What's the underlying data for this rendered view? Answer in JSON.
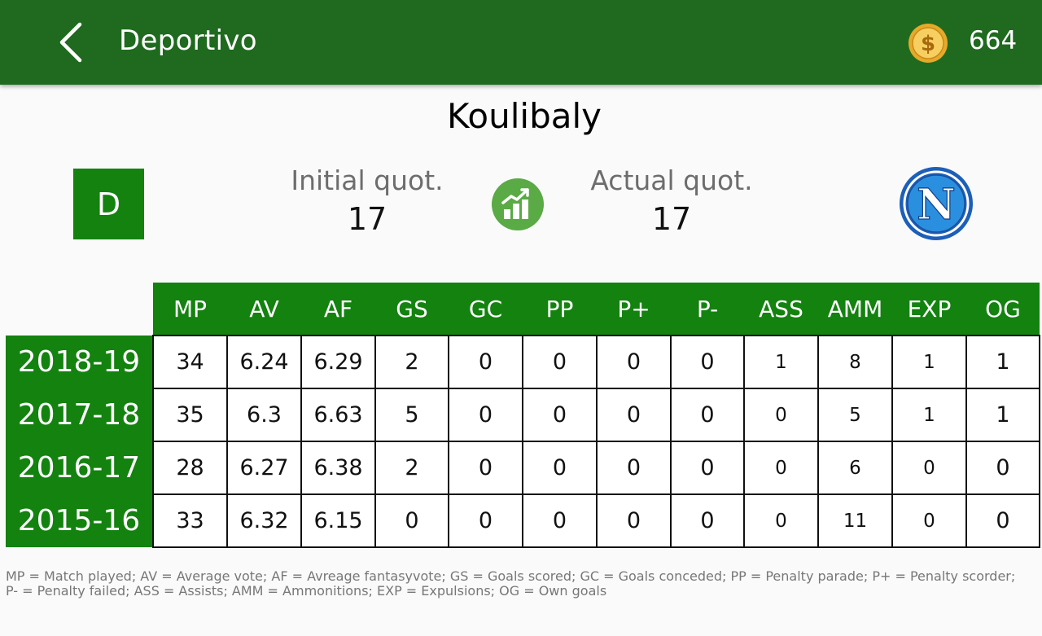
{
  "header": {
    "title": "Deportivo",
    "coins": "664",
    "back_icon": "chevron-left-icon",
    "coin_icon": "coin-icon"
  },
  "player": {
    "name": "Koulibaly",
    "role": "D",
    "initial_label": "Initial quot.",
    "initial_value": "17",
    "actual_label": "Actual quot.",
    "actual_value": "17",
    "trend_icon": "trend-chart-icon",
    "team_logo_letter": "N"
  },
  "table": {
    "columns": [
      "MP",
      "AV",
      "AF",
      "GS",
      "GC",
      "PP",
      "P+",
      "P-",
      "ASS",
      "AMM",
      "EXP",
      "OG"
    ],
    "rows": [
      {
        "season": "2018-19",
        "values": [
          "34",
          "6.24",
          "6.29",
          "2",
          "0",
          "0",
          "0",
          "0",
          "1",
          "8",
          "1",
          "1"
        ]
      },
      {
        "season": "2017-18",
        "values": [
          "35",
          "6.3",
          "6.63",
          "5",
          "0",
          "0",
          "0",
          "0",
          "0",
          "5",
          "1",
          "1"
        ]
      },
      {
        "season": "2016-17",
        "values": [
          "28",
          "6.27",
          "6.38",
          "2",
          "0",
          "0",
          "0",
          "0",
          "0",
          "6",
          "0",
          "0"
        ]
      },
      {
        "season": "2015-16",
        "values": [
          "33",
          "6.32",
          "6.15",
          "0",
          "0",
          "0",
          "0",
          "0",
          "0",
          "11",
          "0",
          "0"
        ]
      }
    ]
  },
  "legend": "MP = Match played; AV = Average vote; AF = Avreage fantasyvote; GS = Goals scored; GC = Goals conceded; PP = Penalty parade; P+ = Penalty scorder; P- = Penalty failed; ASS = Assists; AMM = Ammonitions; EXP = Expulsions; OG = Own goals",
  "colors": {
    "appbar": "#1f6a1f",
    "green": "#13820f",
    "trend_green": "#5aaa45",
    "coin_gold": "#f2c14e"
  }
}
